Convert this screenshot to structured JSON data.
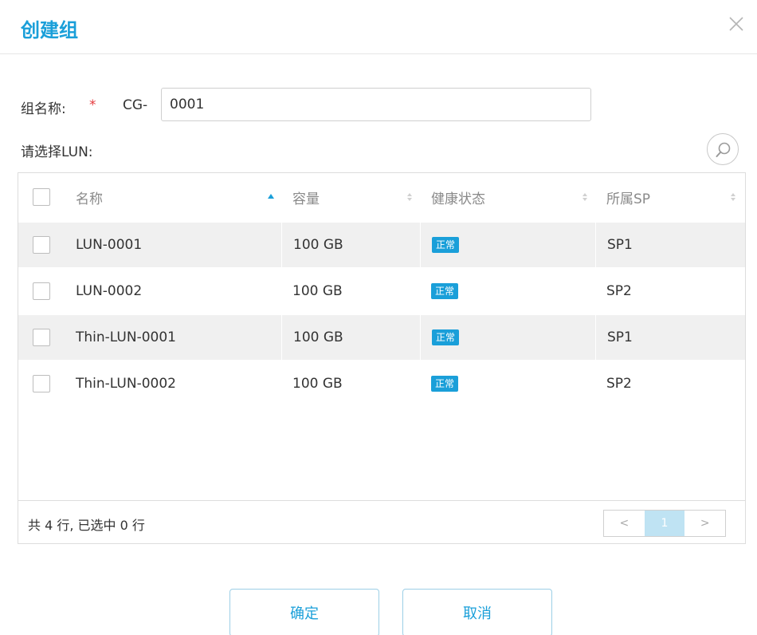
{
  "dialog": {
    "title": "创建组",
    "close_icon": "close-icon"
  },
  "form": {
    "name_label": "组名称:",
    "required_mark": "*",
    "prefix": "CG-",
    "name_value": "0001",
    "lun_label": "请选择LUN:",
    "search_icon": "search-icon"
  },
  "table": {
    "columns": [
      {
        "label": "名称",
        "sort": "asc"
      },
      {
        "label": "容量",
        "sort": "none"
      },
      {
        "label": "健康状态",
        "sort": "none"
      },
      {
        "label": "所属SP",
        "sort": "none"
      }
    ],
    "rows": [
      {
        "name": "LUN-0001",
        "capacity": "100 GB",
        "status": "正常",
        "sp": "SP1"
      },
      {
        "name": "LUN-0002",
        "capacity": "100 GB",
        "status": "正常",
        "sp": "SP2"
      },
      {
        "name": "Thin-LUN-0001",
        "capacity": "100 GB",
        "status": "正常",
        "sp": "SP1"
      },
      {
        "name": "Thin-LUN-0002",
        "capacity": "100 GB",
        "status": "正常",
        "sp": "SP2"
      }
    ],
    "footer_count": "共 4 行, 已选中 0 行",
    "pager": {
      "prev": "<",
      "current": "1",
      "next": ">"
    }
  },
  "buttons": {
    "ok": "确定",
    "cancel": "取消"
  },
  "colors": {
    "accent": "#1a9fd9",
    "required": "#e4393c",
    "row_alt": "#f0f0f0"
  }
}
